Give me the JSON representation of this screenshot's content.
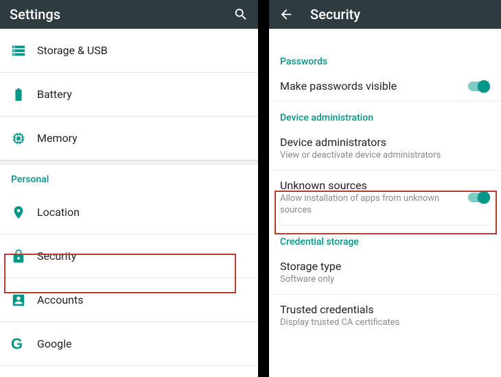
{
  "colors": {
    "accent": "#009688",
    "topbar": "#2e3c42",
    "highlight": "#b83a2e"
  },
  "left": {
    "title": "Settings",
    "sections": {
      "device_items": [
        {
          "icon": "storage-icon",
          "label": "Storage & USB"
        },
        {
          "icon": "battery-icon",
          "label": "Battery"
        },
        {
          "icon": "memory-icon",
          "label": "Memory"
        }
      ],
      "personal_header": "Personal",
      "personal_items": [
        {
          "icon": "location-icon",
          "label": "Location"
        },
        {
          "icon": "lock-icon",
          "label": "Security"
        },
        {
          "icon": "accounts-icon",
          "label": "Accounts"
        },
        {
          "icon": "google-icon",
          "label": "Google"
        }
      ]
    }
  },
  "right": {
    "title": "Security",
    "passwords_header": "Passwords",
    "passwords_item": {
      "label": "Make passwords visible",
      "toggle": true
    },
    "device_admin_header": "Device administration",
    "device_admin_item": {
      "label": "Device administrators",
      "sub": "View or deactivate device administrators"
    },
    "unknown_sources_item": {
      "label": "Unknown sources",
      "sub": "Allow installation of apps from unknown sources",
      "toggle": true
    },
    "credential_header": "Credential storage",
    "storage_type_item": {
      "label": "Storage type",
      "sub": "Software only"
    },
    "trusted_item": {
      "label": "Trusted credentials",
      "sub": "Display trusted CA certificates"
    }
  }
}
